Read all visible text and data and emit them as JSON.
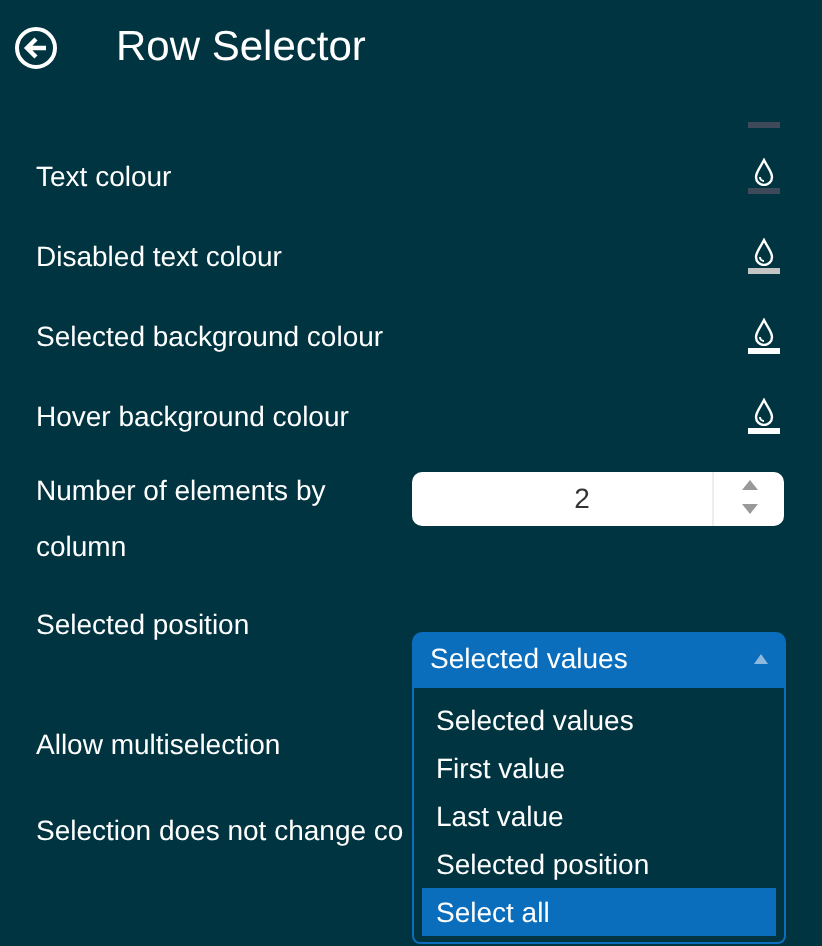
{
  "header": {
    "title": "Row Selector"
  },
  "partial_swatch": {
    "color": "#3e4a5a"
  },
  "colour_rows": [
    {
      "label": "Text colour",
      "color": "#3e4a5a"
    },
    {
      "label": "Disabled text colour",
      "color": "#c4c4c4"
    },
    {
      "label": "Selected background colour",
      "color": "#ffffff"
    },
    {
      "label": "Hover background colour",
      "color": "#ffffff"
    }
  ],
  "elements_by_column": {
    "label_line_1": "Number of elements by",
    "label_line_2": "column",
    "value": "2"
  },
  "selected_position": {
    "label": "Selected position",
    "value": "Selected values",
    "expanded": true,
    "options": [
      {
        "label": "Selected values",
        "highlighted": false
      },
      {
        "label": "First value",
        "highlighted": false
      },
      {
        "label": "Last value",
        "highlighted": false
      },
      {
        "label": "Selected position",
        "highlighted": false
      },
      {
        "label": "Select all",
        "highlighted": true
      }
    ]
  },
  "allow_multiselection": {
    "label": "Allow multiselection"
  },
  "selection_no_change": {
    "label": "Selection does not change co"
  }
}
